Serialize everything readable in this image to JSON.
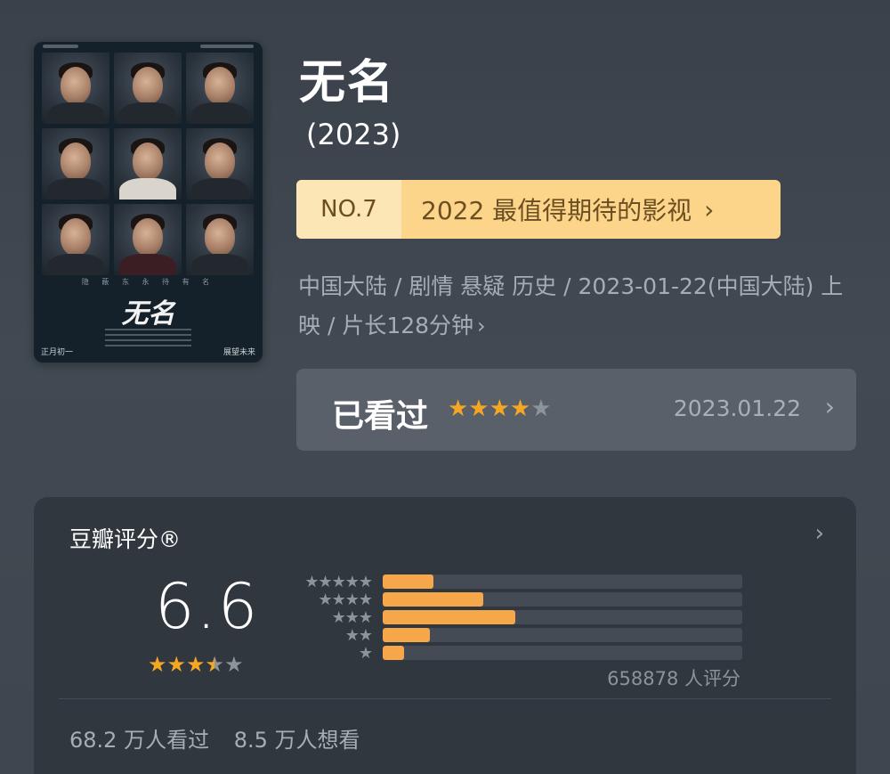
{
  "poster": {
    "caption": "隐 蔽 东 永 待 有 名",
    "logo_text": "无名",
    "footer_left": "正月初一",
    "footer_right": "展望未来"
  },
  "movie": {
    "title": "无名",
    "year": "(2023)"
  },
  "rank": {
    "number": "NO.7",
    "list_name": "2022 最值得期待的影视",
    "chevron": "›"
  },
  "meta": {
    "line": "中国大陆 / 剧情 悬疑 历史 / 2023-01-22(中国大陆) 上映 / 片长128分钟",
    "chevron": "›"
  },
  "watched": {
    "label": "已看过",
    "stars_on": "★★★★",
    "stars_off": "★",
    "date": "2023.01.22",
    "chevron": "›"
  },
  "rating": {
    "title": "豆瓣评分®",
    "chevron": "›",
    "score": "6.6",
    "stars_full": "★★★",
    "star_half": "★",
    "stars_empty": "★",
    "distribution": [
      {
        "stars": "★★★★★",
        "fraction": 0.14
      },
      {
        "stars": "★★★★",
        "fraction": 0.28
      },
      {
        "stars": "★★★",
        "fraction": 0.37
      },
      {
        "stars": "★★",
        "fraction": 0.13
      },
      {
        "stars": "★",
        "fraction": 0.06
      }
    ],
    "votes": "658878 人评分",
    "watched_count": "68.2 万人看过",
    "want_count": "8.5 万人想看"
  },
  "colors": {
    "star_active": "#f5a623",
    "bar_fill": "#f5a74a",
    "rank_banner": "#fcd58a"
  }
}
